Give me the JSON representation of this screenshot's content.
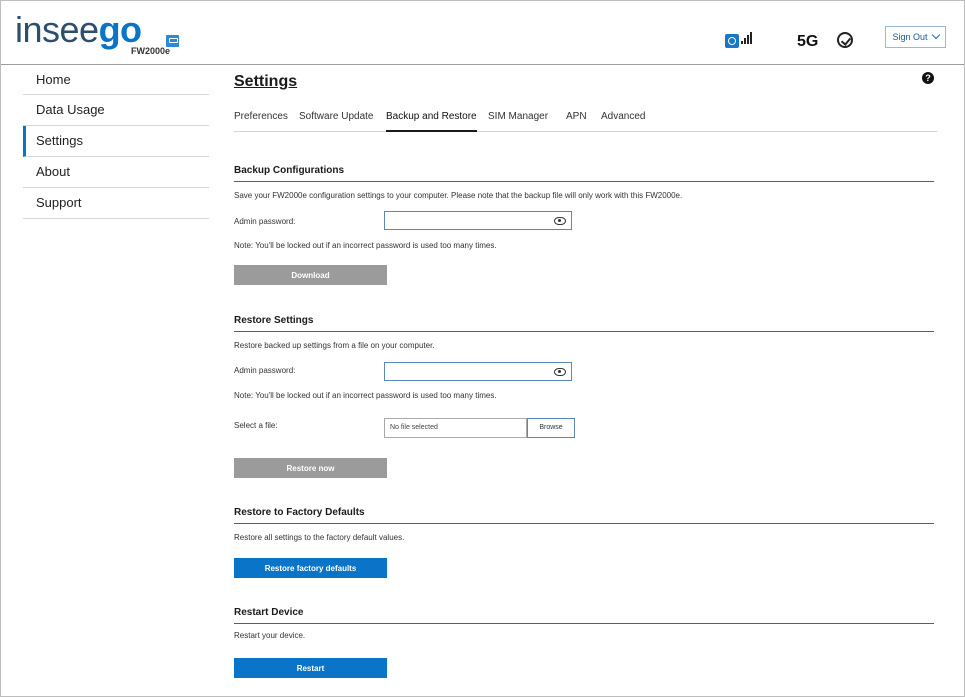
{
  "header": {
    "logo_part1": "insee",
    "logo_part2": "go",
    "model": "FW2000e",
    "network_badge": "5G",
    "sign_out_label": "Sign Out",
    "icons": [
      "router-icon",
      "signal-icon",
      "signal-bars-icon",
      "security-check-icon",
      "chevron-down-icon"
    ]
  },
  "sidebar": {
    "items": [
      {
        "label": "Home"
      },
      {
        "label": "Data Usage"
      },
      {
        "label": "Settings",
        "active": true
      },
      {
        "label": "About"
      },
      {
        "label": "Support"
      }
    ]
  },
  "main": {
    "title": "Settings",
    "help": "?",
    "tabs": [
      {
        "label": "Preferences"
      },
      {
        "label": "Software Update"
      },
      {
        "label": "Backup and Restore",
        "active": true
      },
      {
        "label": "SIM Manager"
      },
      {
        "label": "APN"
      },
      {
        "label": "Advanced"
      }
    ],
    "backup": {
      "title": "Backup Configurations",
      "desc": "Save your FW2000e configuration settings to your computer. Please note that the backup file will only work with this FW2000e.",
      "pw_label": "Admin password:",
      "pw_value": "",
      "note": "Note: You'll be locked out if an incorrect password is used too many times.",
      "button": "Download"
    },
    "restore": {
      "title": "Restore Settings",
      "desc": "Restore backed up settings from a file on your computer.",
      "pw_label": "Admin password:",
      "pw_value": "",
      "note": "Note: You'll be locked out if an incorrect password is used too many times.",
      "file_label": "Select a file:",
      "file_value": "No file selected",
      "browse": "Browse",
      "button": "Restore now"
    },
    "factory": {
      "title": "Restore to Factory Defaults",
      "desc": "Restore all settings to the factory default values.",
      "button": "Restore factory defaults"
    },
    "restart": {
      "title": "Restart Device",
      "desc": "Restart your device.",
      "button": "Restart"
    }
  },
  "colors": {
    "accent": "#0a74c9",
    "logo_dark": "#2d4e6e",
    "disabled_button": "#9b9b9b"
  }
}
